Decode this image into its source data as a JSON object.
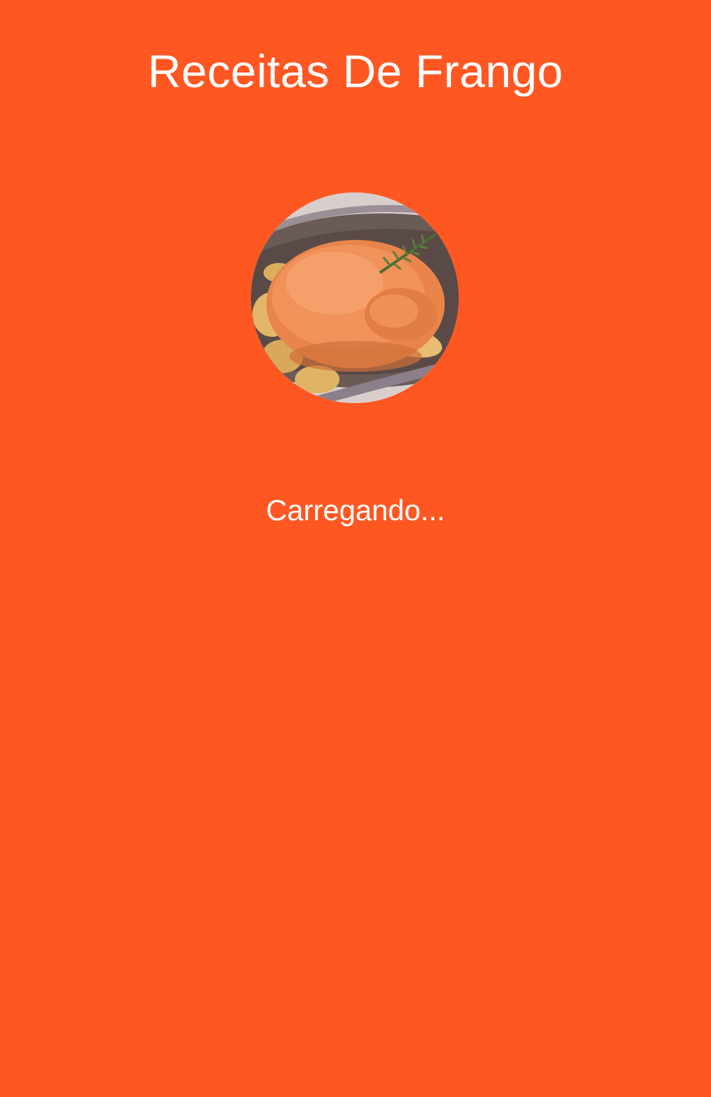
{
  "app": {
    "title": "Receitas De Frango"
  },
  "splash": {
    "image": "roast-chicken-image",
    "loading_text": "Carregando..."
  },
  "colors": {
    "background": "#FF5722",
    "text": "#FFFFFF"
  }
}
